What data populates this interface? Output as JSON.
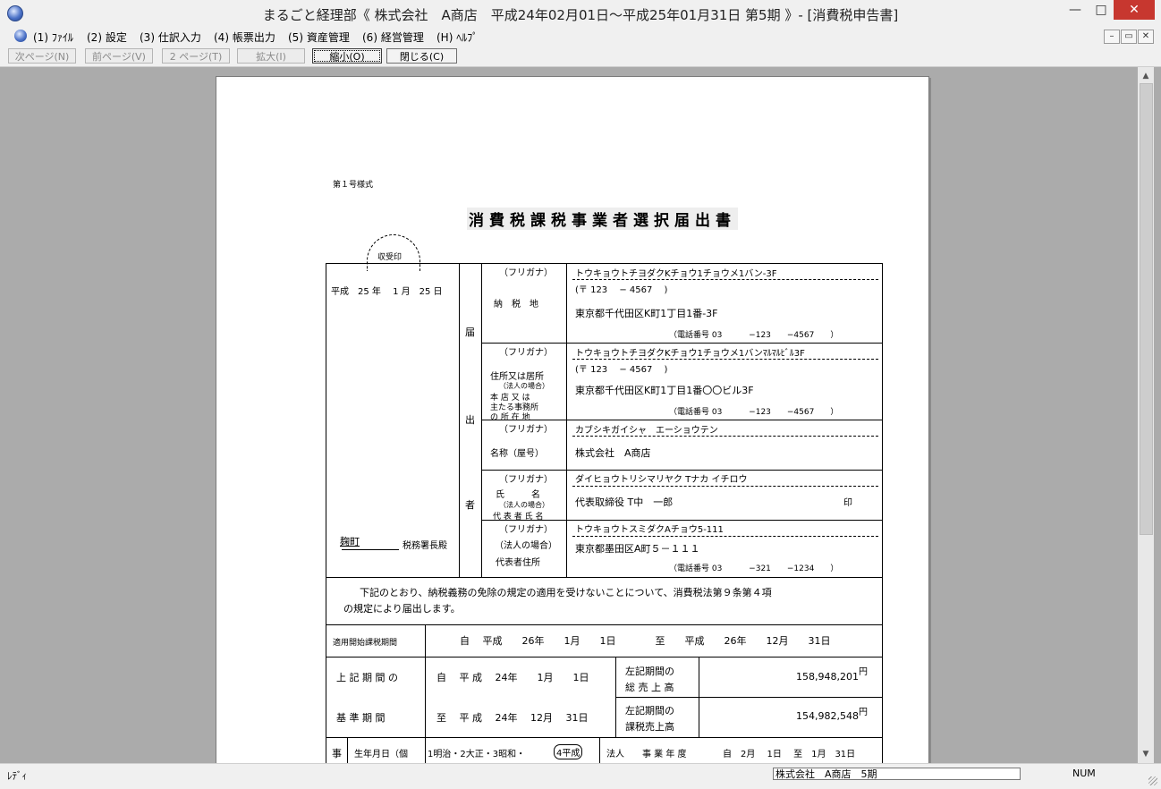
{
  "window": {
    "title": "まるごと経理部《 株式会社　A商店　平成24年02月01日～平成25年01月31日 第5期 》- [消費税申告書]",
    "min": "—",
    "max": "□",
    "close": "✕"
  },
  "menu": [
    {
      "label": "(1) ﾌｧｲﾙ"
    },
    {
      "label": "(2) 設定"
    },
    {
      "label": "(3) 仕訳入力"
    },
    {
      "label": "(4) 帳票出力"
    },
    {
      "label": "(5) 資産管理"
    },
    {
      "label": "(6) 経営管理"
    },
    {
      "label": "(H) ﾍﾙﾌﾟ"
    }
  ],
  "mdi": {
    "min": "–",
    "restore": "▭",
    "close": "✕"
  },
  "toolbar": {
    "next": "次ページ(N)",
    "prev": "前ページ(V)",
    "page": "2 ページ(T)",
    "zoom_in": "拡大(I)",
    "zoom_out": "縮小(O)",
    "close": "閉じる(C)"
  },
  "form": {
    "form_no": "第１号様式",
    "title": "消費税課税事業者選択届出書",
    "stamp": "収受印",
    "date": "平成　25 年　 1 月　25 日",
    "tax_office_name": "麹町",
    "tax_office_suffix": "税務署長殿",
    "todoke": "届",
    "de": "出",
    "sha": "者",
    "furigana": "（フリガナ）",
    "r1": {
      "label": "納　税　地",
      "kana": "トウキョウトチヨダクKチョウ1チョウメ1バン-3F",
      "zip": "(〒 123　 − 4567　 )",
      "addr": "東京都千代田区K町1丁目1番-3F",
      "tel": "（電話番号 03　　　 −123　　−4567　　）"
    },
    "r2": {
      "label1": "住所又は居所",
      "label2": "（法人の場合）",
      "label3": "本 店 又 は",
      "label4": "主たる事務所",
      "label5": "の 所 在 地",
      "kana": "トウキョウトチヨダクKチョウ1チョウメ1バンﾏﾙﾏﾙﾋﾞﾙ3F",
      "zip": "(〒 123　 − 4567　 )",
      "addr": "東京都千代田区K町1丁目1番〇〇ビル3F",
      "tel": "（電話番号 03　　　 −123　　−4567　　）"
    },
    "r3": {
      "label": "名称（屋号）",
      "kana": "カブシキガイシャ　エーショウテン",
      "name": "株式会社　A商店"
    },
    "r4": {
      "label1": "氏　　　名",
      "label2": "（法人の場合）",
      "label3": "代 表 者 氏 名",
      "kana": "ダイヒョウトリシマリヤク Tナカ イチロウ",
      "name": "代表取締役 T中　一郎",
      "seal": "印"
    },
    "r5": {
      "label1": "（法人の場合）",
      "label2": "代表者住所",
      "kana": "トウキョウトスミダクAチョウ5-111",
      "addr": "東京都墨田区A町５－１１１",
      "tel": "（電話番号 03　　　 −321　　−1234　　）"
    },
    "notice1": "下記のとおり、納税義務の免除の規定の適用を受けないことについて、消費税法第９条第４項",
    "notice2": "の規定により届出します。",
    "period_label": "適用開始課税期間",
    "period_value": "自　 平成　　26年　　1月　　1日　　　　至　　平成　　26年　　12月　　31日",
    "base_label1": "上 記 期 間 の",
    "base_label2": "基 準 期 間",
    "from_value": "自　 平 成　 24年　　1月　　1日",
    "to_value": "至　 平 成　 24年　 12月　 31日",
    "sales_label1": "左記期間の",
    "sales_label2": "総 売 上 高",
    "taxable_label1": "左記期間の",
    "taxable_label2": "課税売上高",
    "sales_value": "158,948,201",
    "taxable_value": "154,982,548",
    "yen": "円",
    "bottom_ji": "事",
    "bottom_birth": "生年月日（個",
    "bottom_era_a": "1明治・2大正・3昭和・",
    "bottom_era_b": "4平成",
    "bottom_corp": "法人",
    "bottom_fy_label": "事 業 年 度",
    "bottom_fy_value": "自　2月　 1日　 至　1月　31日"
  },
  "status": {
    "ready": "ﾚﾃﾞｨ",
    "company": "株式会社　A商店　5期",
    "num": "NUM"
  }
}
